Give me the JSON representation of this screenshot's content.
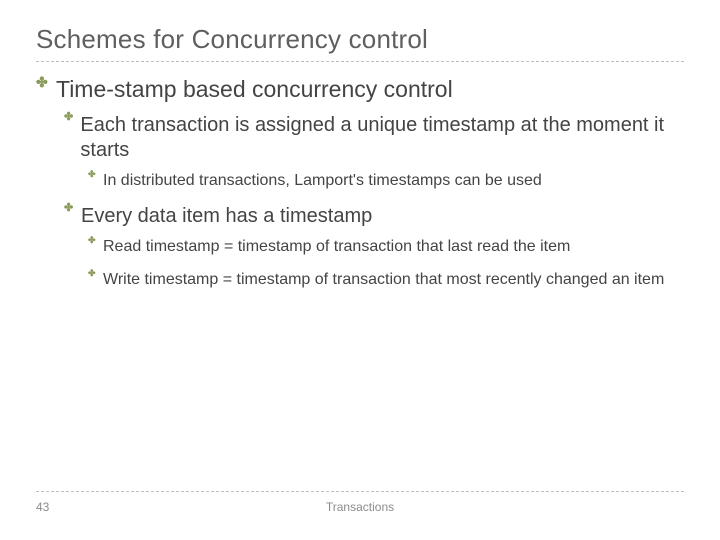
{
  "slide": {
    "title": "Schemes for Concurrency control",
    "bullet1": "Time-stamp based concurrency control",
    "bullet1_1": "Each transaction is assigned a unique timestamp at the moment it starts",
    "bullet1_1_1": "In distributed transactions, Lamport's timestamps can be used",
    "bullet1_2": "Every data item has a timestamp",
    "bullet1_2_1": "Read timestamp = timestamp of transaction that last read the item",
    "bullet1_2_2": "Write timestamp = timestamp of transaction that most recently changed an item"
  },
  "footer": {
    "page": "43",
    "topic": "Transactions"
  }
}
